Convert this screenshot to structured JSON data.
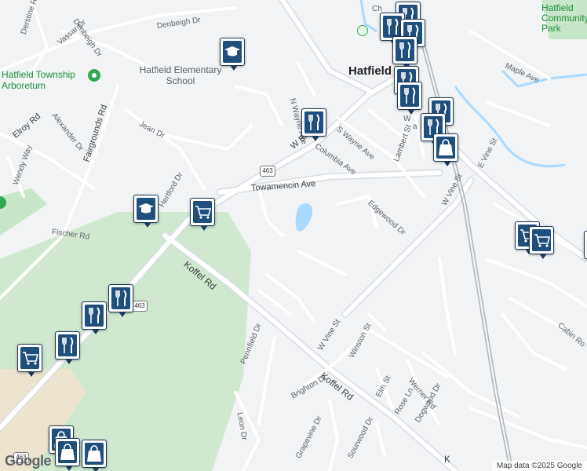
{
  "map": {
    "town_label": "Hatfield",
    "colors": {
      "background": "#f1f3f4",
      "road": "#ffffff",
      "major_road": "#d8dde3",
      "park": "#c8e6c9",
      "water": "#aadaff",
      "marker_fill": "#1f4f7c"
    },
    "labels": [
      {
        "id": "derstine-rd",
        "text": "Derstine Rd"
      },
      {
        "id": "denbeigh-dr-1",
        "text": "Denbeigh Dr"
      },
      {
        "id": "denbeigh-dr-2",
        "text": "Denbeigh Dr"
      },
      {
        "id": "vassar-dr",
        "text": "Vassar Dr"
      },
      {
        "id": "hatfield-elementary",
        "text": "Hatfield Elementary School"
      },
      {
        "id": "arboretum",
        "text": "Hatfield Township Arboretum"
      },
      {
        "id": "alexander-dr",
        "text": "Alexander Dr"
      },
      {
        "id": "jean-dr",
        "text": "Jean Dr"
      },
      {
        "id": "fairgrounds-rd",
        "text": "Fairgrounds Rd"
      },
      {
        "id": "elroy-rd",
        "text": "Elroy Rd"
      },
      {
        "id": "wendy-way",
        "text": "Wendy Way"
      },
      {
        "id": "hertford-dr",
        "text": "Hertford Dr"
      },
      {
        "id": "fischer-rd",
        "text": "Fischer Rd"
      },
      {
        "id": "n-wayne-ave",
        "text": "N Wayne Ave"
      },
      {
        "id": "w-broad",
        "text": "W Br"
      },
      {
        "id": "s-wayne-ave",
        "text": "S Wayne Ave"
      },
      {
        "id": "columbia-ave",
        "text": "Columbia Ave"
      },
      {
        "id": "lambert-st",
        "text": "Lambert St"
      },
      {
        "id": "e-vine-st",
        "text": "E Vine St"
      },
      {
        "id": "w-vine-st-1",
        "text": "W Vine St"
      },
      {
        "id": "towamencin-ave",
        "text": "Towamencin Ave"
      },
      {
        "id": "edgewood-dr",
        "text": "Edgewood Dr"
      },
      {
        "id": "koffel-rd-1",
        "text": "Koffel Rd"
      },
      {
        "id": "w-vine-st-2",
        "text": "W Vine St"
      },
      {
        "id": "pennfield-dr",
        "text": "Pennfield Dr"
      },
      {
        "id": "winston-st",
        "text": "Winston St"
      },
      {
        "id": "koffel-rd-2",
        "text": "Koffel Rd"
      },
      {
        "id": "brighton-dr",
        "text": "Brighton Dr"
      },
      {
        "id": "elm-st",
        "text": "Elm St"
      },
      {
        "id": "werner-rd",
        "text": "Werner Rd"
      },
      {
        "id": "rose-ln",
        "text": "Rose Ln"
      },
      {
        "id": "dogwood-dr",
        "text": "Dogwood Dr"
      },
      {
        "id": "leon-dr",
        "text": "Leon Dr"
      },
      {
        "id": "grapevine-dr",
        "text": "Grapevine Dr"
      },
      {
        "id": "sourwood-dr",
        "text": "Sourwood Dr"
      },
      {
        "id": "maple-ave",
        "text": "Maple Ave"
      },
      {
        "id": "cabin-rd",
        "text": "Cabin Ro"
      },
      {
        "id": "hatfield-park",
        "text": "Hatfield Community Park"
      },
      {
        "id": "ch",
        "text": "Ch"
      },
      {
        "id": "w-rd",
        "text": "W"
      },
      {
        "id": "edge-a",
        "text": "a"
      },
      {
        "id": "k-bottom",
        "text": "K"
      }
    ],
    "shields": [
      "463",
      "463",
      "463"
    ],
    "markers": [
      "restaurant",
      "restaurant",
      "restaurant",
      "restaurant",
      "restaurant",
      "restaurant",
      "restaurant",
      "restaurant",
      "restaurant",
      "restaurant",
      "restaurant",
      "restaurant",
      "school",
      "school",
      "shopping-cart",
      "shopping-cart",
      "shopping-cart",
      "shopping-cart",
      "shopping-cart",
      "shopping-bag",
      "shopping-bag",
      "shopping-bag",
      "shopping-bag"
    ],
    "google_logo": "Google",
    "attribution": "Map data ©2025 Google"
  }
}
